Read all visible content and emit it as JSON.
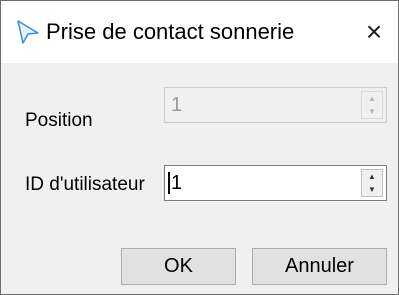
{
  "title": "Prise de contact sonnerie",
  "close_icon": "×",
  "fields": {
    "position": {
      "label": "Position",
      "value": "1",
      "enabled": false
    },
    "user_id": {
      "label": "ID d'utilisateur",
      "value": "1",
      "enabled": true
    }
  },
  "spin_up_icon": "▲",
  "spin_down_icon": "▼",
  "buttons": {
    "ok": "OK",
    "cancel": "Annuler"
  },
  "colors": {
    "dialog_bg": "#f0f0f0",
    "titlebar_bg": "#ffffff",
    "app_icon": "#3c8ee0"
  }
}
